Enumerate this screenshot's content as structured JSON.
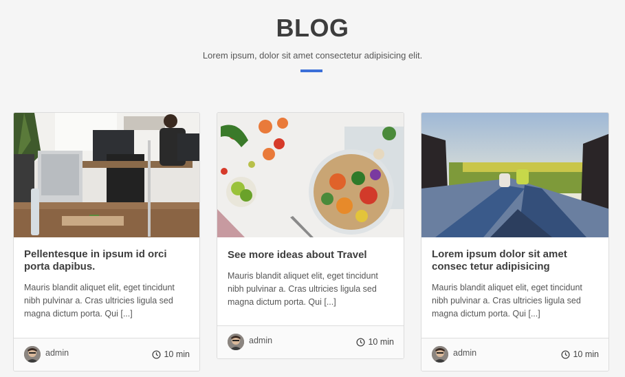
{
  "header": {
    "title": "BLOG",
    "subtitle": "Lorem ipsum, dolor sit amet consectetur adipisicing elit."
  },
  "colors": {
    "accent": "#3b6fd8",
    "background": "#f5f5f5"
  },
  "posts": [
    {
      "title": "Pellentesque in ipsum id orci porta dapibus.",
      "excerpt": "Mauris blandit aliquet elit, eget tincidunt nibh pulvinar a. Cras ultricies ligula sed magna dictum porta. Qui [...]",
      "author": "admin",
      "read_time": "10 min",
      "image": "office-photo"
    },
    {
      "title": "See more ideas about Travel",
      "excerpt": "Mauris blandit aliquet elit, eget tincidunt nibh pulvinar a. Cras ultricies ligula sed magna dictum porta. Qui [...]",
      "author": "admin",
      "read_time": "10 min",
      "image": "salad-bowl-photo"
    },
    {
      "title": "Lorem ipsum dolor sit amet consec tetur adipisicing",
      "excerpt": "Mauris blandit aliquet elit, eget tincidunt nibh pulvinar a. Cras ultricies ligula sed magna dictum porta. Qui [...]",
      "author": "admin",
      "read_time": "10 min",
      "image": "car-trunk-view-photo"
    }
  ]
}
